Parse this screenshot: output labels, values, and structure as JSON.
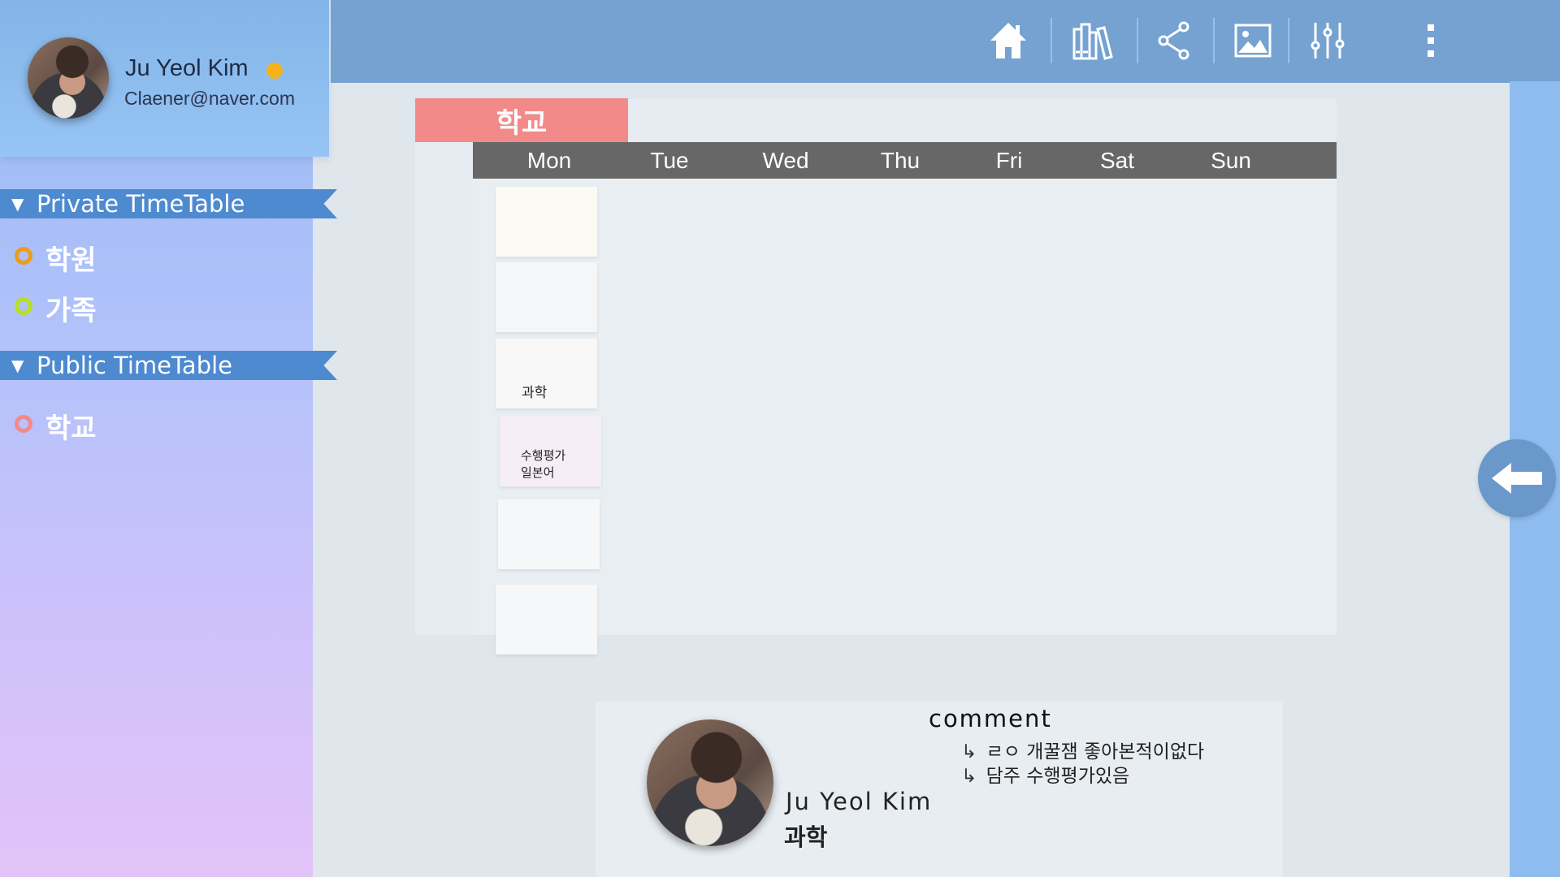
{
  "profile": {
    "name": "Ju Yeol Kim",
    "email": "Claener@naver.com",
    "status_color": "#f5b21a"
  },
  "sidebar": {
    "private_header": "Private TimeTable",
    "private_items": [
      {
        "label": "학원",
        "color": "#f09a1a"
      },
      {
        "label": "가족",
        "color": "#b9e01e"
      }
    ],
    "public_header": "Public TimeTable",
    "public_items": [
      {
        "label": "학교",
        "color": "#f08a8a"
      }
    ]
  },
  "toolbar": {
    "icons": [
      "home-icon",
      "library-icon",
      "share-icon",
      "image-icon",
      "sliders-icon",
      "more-vertical-icon"
    ]
  },
  "timetable": {
    "title": "학교",
    "days": [
      "Mon",
      "Tue",
      "Wed",
      "Thu",
      "Fri",
      "Sat",
      "Sun"
    ],
    "mon_cells": [
      {
        "text": "",
        "color": "#fbfbf4"
      },
      {
        "text": "",
        "color": "#f5f6f8"
      },
      {
        "text": "과학",
        "color": "#f8f8f9"
      },
      {
        "text": "수행평가\n일본어",
        "color": "#f6eef6"
      },
      {
        "text": "",
        "color": "#f6f7f9"
      },
      {
        "text": "",
        "color": "#f6f7f9"
      }
    ]
  },
  "comment": {
    "title": "comment",
    "lines": [
      "ㄹㅇ 개꿀잼 좋아본적이없다",
      "담주 수행평가있음"
    ],
    "user": "Ju Yeol Kim",
    "subject": "과학"
  },
  "colors": {
    "topbar": "#75a2d1",
    "accent_header": "#4d8ad0",
    "title_tab": "#f28a8a"
  }
}
